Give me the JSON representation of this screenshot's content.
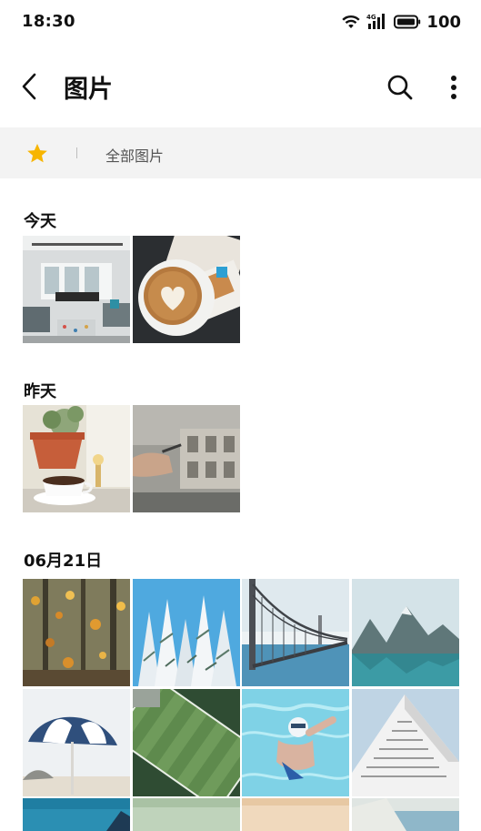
{
  "status_bar": {
    "time": "18:30",
    "network": "4G",
    "battery": "100"
  },
  "header": {
    "title": "图片"
  },
  "filter": {
    "album_label": "全部图片"
  },
  "sections": [
    {
      "date": "今天",
      "photos": [
        "office-interior",
        "latte-art"
      ]
    },
    {
      "date": "昨天",
      "photos": [
        "coffee-plant",
        "window-hand"
      ]
    },
    {
      "date": "06月21日",
      "photos": [
        "autumn-forest",
        "snowy-pines",
        "golden-gate-bridge",
        "mountain-lake",
        "beach-umbrella",
        "football-field",
        "swimmer",
        "white-building",
        "teal-water",
        "pale-green",
        "beige-wall",
        "sea-building"
      ]
    }
  ],
  "colors": {
    "accent_star": "#F7B500",
    "filter_bg": "#F3F3F3"
  }
}
